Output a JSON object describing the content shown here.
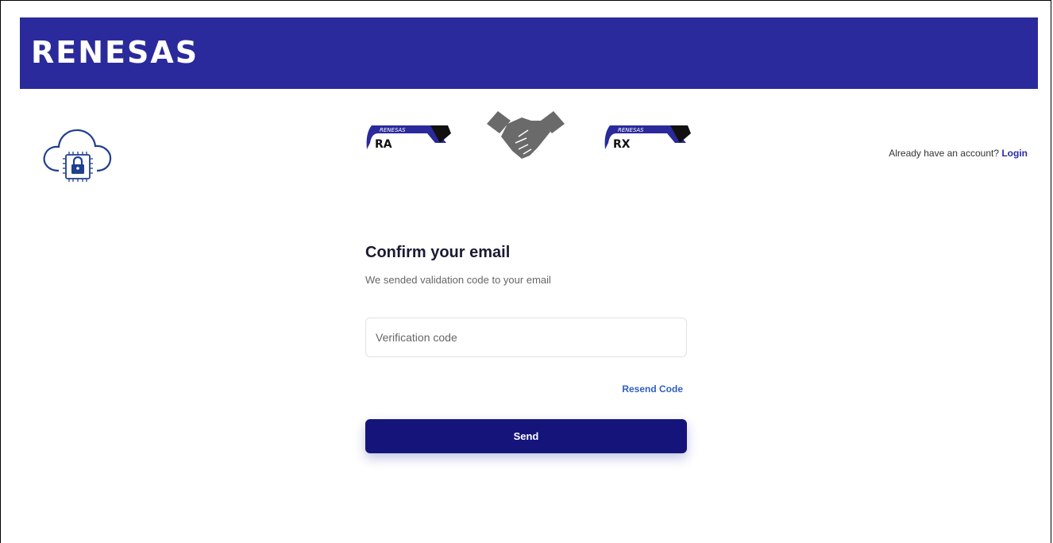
{
  "header": {
    "brand": "RENESAS",
    "bar_color": "#2a2a9c"
  },
  "logos": {
    "cloud": "cloud-lock-chip-icon",
    "ra_badge": {
      "maker": "RENESAS",
      "name": "RA"
    },
    "handshake": "handshake-icon",
    "rx_badge": {
      "maker": "RENESAS",
      "name": "RX"
    }
  },
  "account": {
    "prompt": "Already have an account?",
    "login_label": "Login"
  },
  "form": {
    "title": "Confirm your email",
    "subtitle": "We sended validation code to your email",
    "code_placeholder": "Verification code",
    "code_value": "",
    "resend_label": "Resend Code",
    "send_label": "Send"
  },
  "colors": {
    "button": "#14147a",
    "link": "#2f5fbf",
    "login_link": "#2a2aa8"
  }
}
